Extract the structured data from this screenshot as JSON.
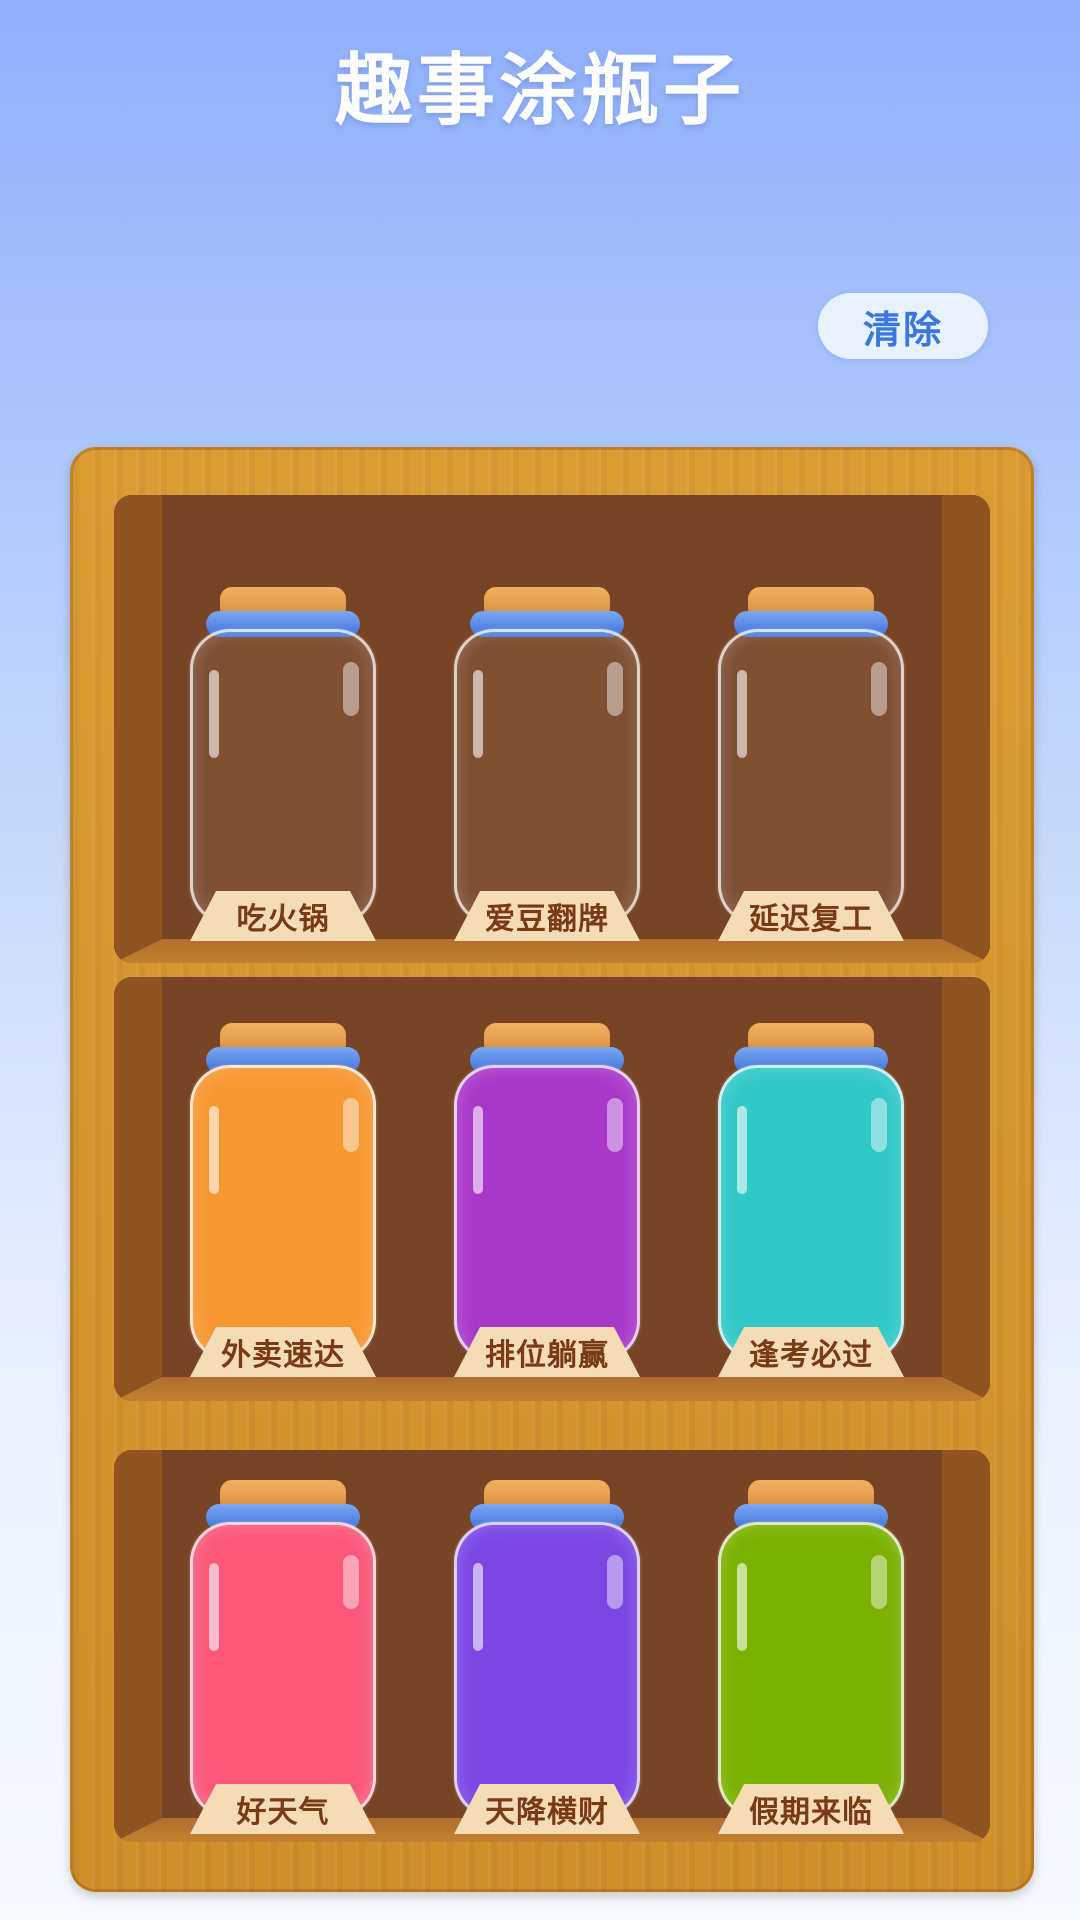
{
  "title": "趣事涂瓶子",
  "clear_button": "清除",
  "colors": {
    "empty": "transparent"
  },
  "icons": {
    "lid": "jar-lid-icon"
  },
  "shelves": [
    {
      "jars": [
        {
          "label": "吃火锅",
          "fill": "empty",
          "color": "#6f4124"
        },
        {
          "label": "爱豆翻牌",
          "fill": "empty",
          "color": "#6f4124"
        },
        {
          "label": "延迟复工",
          "fill": "empty",
          "color": "#6f4124"
        }
      ]
    },
    {
      "jars": [
        {
          "label": "外卖速达",
          "fill": "filled",
          "color": "#f79731"
        },
        {
          "label": "排位躺赢",
          "fill": "filled",
          "color": "#a838c9"
        },
        {
          "label": "逢考必过",
          "fill": "filled",
          "color": "#31c8c8"
        }
      ]
    },
    {
      "jars": [
        {
          "label": "好天气",
          "fill": "filled",
          "color": "#fb587a"
        },
        {
          "label": "天降横财",
          "fill": "filled",
          "color": "#7a46e4"
        },
        {
          "label": "假期来临",
          "fill": "filled",
          "color": "#7bb100"
        }
      ]
    }
  ]
}
